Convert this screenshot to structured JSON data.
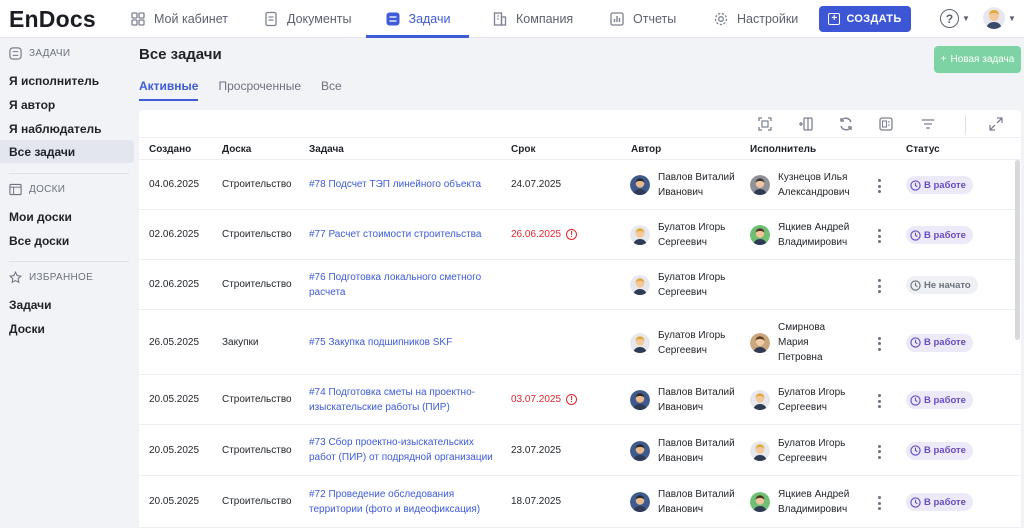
{
  "app": {
    "logo": "EnDocs"
  },
  "nav": {
    "items": [
      {
        "label": "Мой кабинет",
        "icon": "dashboard-icon"
      },
      {
        "label": "Документы",
        "icon": "document-icon"
      },
      {
        "label": "Задачи",
        "icon": "tasks-icon",
        "active": true
      },
      {
        "label": "Компания",
        "icon": "building-icon"
      },
      {
        "label": "Отчеты",
        "icon": "report-icon"
      },
      {
        "label": "Настройки",
        "icon": "gear-icon"
      }
    ],
    "create_label": "СОЗДАТЬ",
    "help_label": "?"
  },
  "sidebar": {
    "tasks_title": "ЗАДАЧИ",
    "tasks_items": [
      "Я исполнитель",
      "Я автор",
      "Я наблюдатель",
      "Все задачи"
    ],
    "boards_title": "ДОСКИ",
    "boards_items": [
      "Мои доски",
      "Все доски"
    ],
    "fav_title": "ИЗБРАННОЕ",
    "fav_items": [
      "Задачи",
      "Доски"
    ]
  },
  "main": {
    "title": "Все задачи",
    "new_task_label": "Новая задача",
    "tabs": [
      "Активные",
      "Просроченные",
      "Все"
    ],
    "columns": [
      "Создано",
      "Доска",
      "Задача",
      "Срок",
      "Автор",
      "Исполнитель",
      "Статус"
    ]
  },
  "rows": [
    {
      "created": "04.06.2025",
      "board": "Строительство",
      "task": "#78 Подсчет ТЭП линейного объекта",
      "due": "24.07.2025",
      "overdue": false,
      "author": "Павлов Виталий Иванович",
      "assignee": "Кузнецов Илья Александрович",
      "status": "В работе"
    },
    {
      "created": "02.06.2025",
      "board": "Строительство",
      "task": "#77 Расчет стоимости строительства",
      "due": "26.06.2025",
      "overdue": true,
      "author": "Булатов Игорь Сергеевич",
      "assignee": "Яцкиев Андрей Владимирович",
      "status": "В работе"
    },
    {
      "created": "02.06.2025",
      "board": "Строительство",
      "task": "#76 Подготовка локального сметного расчета",
      "due": "",
      "overdue": false,
      "author": "Булатов Игорь Сергеевич",
      "assignee": "",
      "status": "Не начато"
    },
    {
      "created": "26.05.2025",
      "board": "Закупки",
      "task": "#75 Закупка подшипников SKF",
      "due": "",
      "overdue": false,
      "author": "Булатов Игорь Сергеевич",
      "assignee": "Смирнова Мария Петровна",
      "status": "В работе"
    },
    {
      "created": "20.05.2025",
      "board": "Строительство",
      "task": "#74 Подготовка сметы на проектно-изыскательские работы (ПИР)",
      "due": "03.07.2025",
      "overdue": true,
      "author": "Павлов Виталий Иванович",
      "assignee": "Булатов Игорь Сергеевич",
      "status": "В работе"
    },
    {
      "created": "20.05.2025",
      "board": "Строительство",
      "task": "#73 Сбор проектно-изыскательских работ (ПИР) от подрядной организации",
      "due": "23.07.2025",
      "overdue": false,
      "author": "Павлов Виталий Иванович",
      "assignee": "Булатов Игорь Сергеевич",
      "status": "В работе"
    },
    {
      "created": "20.05.2025",
      "board": "Строительство",
      "task": "#72 Проведение обследования территории (фото и видеофиксация)",
      "due": "18.07.2025",
      "overdue": false,
      "author": "Павлов Виталий Иванович",
      "assignee": "Яцкиев Андрей Владимирович",
      "status": "В работе"
    }
  ],
  "colors": {
    "accent": "#3d56d6",
    "overdue": "#e0262d",
    "status_working": "#6a4bc4",
    "new_task": "#7dd3a3"
  }
}
